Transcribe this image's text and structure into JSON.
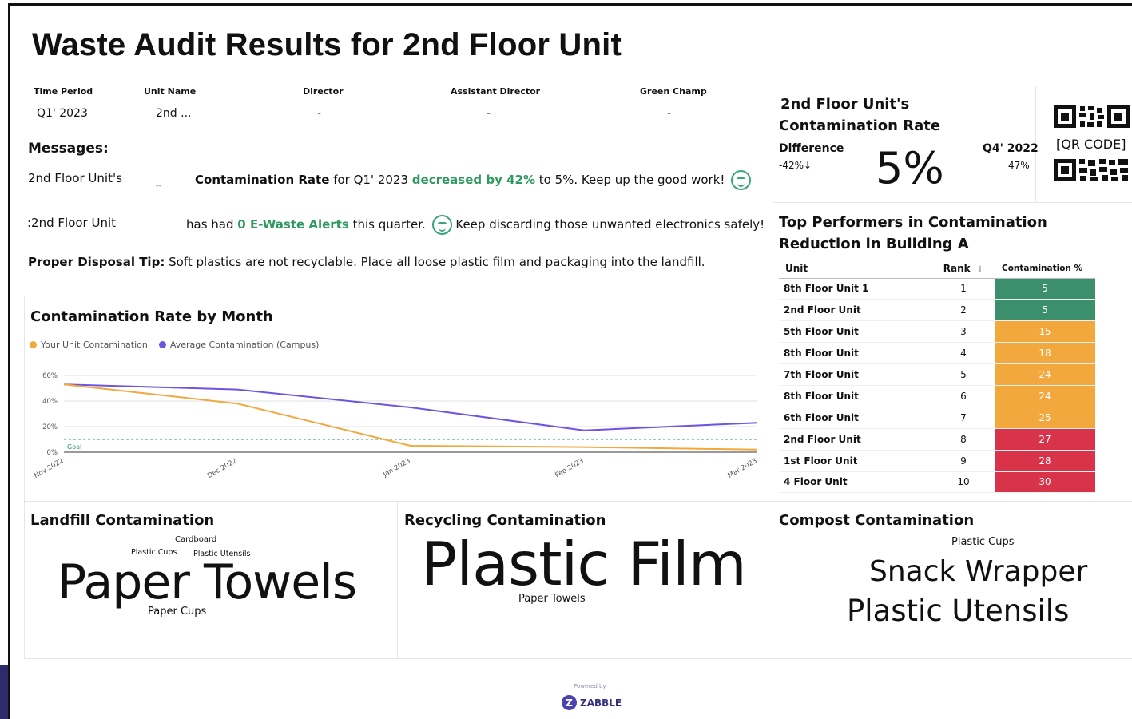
{
  "title": "Waste Audit Results for 2nd Floor Unit",
  "info": {
    "time_period_label": "Time Period",
    "time_period_value": "Q1' 2023",
    "unit_name_label": "Unit Name",
    "unit_name_value": "2nd ...",
    "director_label": "Director",
    "director_value": "-",
    "assistant_director_label": "Assistant Director",
    "assistant_director_value": "-",
    "green_champ_label": "Green Champ",
    "green_champ_value": "-"
  },
  "messages": {
    "heading": "Messages:",
    "msg1_unit": "2nd Floor Unit's",
    "msg1_dash": "--",
    "msg1_bold": "Contamination Rate",
    "msg1_mid": "for Q1' 2023",
    "msg1_green": "decreased by 42%",
    "msg1_end": "to 5%. Keep up the good work!",
    "msg2_unit": ":2nd Floor Unit",
    "msg2_pre": "has had",
    "msg2_green": "0 E-Waste Alerts",
    "msg2_end": "this quarter.",
    "msg2_tail": "Keep discarding those unwanted electronics safely!",
    "tip_bold": "Proper Disposal Tip:",
    "tip_text": "Soft plastics are not recyclable. Place all loose plastic film and packaging into the landfill."
  },
  "kpi": {
    "title_line1": "2nd Floor Unit's",
    "title_line2": "Contamination Rate",
    "difference_label": "Difference",
    "difference_value": "-42%↓",
    "big_value": "5%",
    "prev_label": "Q4' 2022",
    "prev_value": "47%",
    "qr_label": "[QR CODE]"
  },
  "top_performers": {
    "title": "Top Performers in Contamination Reduction in Building A",
    "headers": {
      "unit": "Unit",
      "rank": "Rank",
      "pct": "Contamination %"
    },
    "rows": [
      {
        "unit": "8th Floor Unit 1",
        "rank": "1",
        "pct": "5",
        "color": "#3c8f6d"
      },
      {
        "unit": "2nd  Floor Unit",
        "rank": "2",
        "pct": "5",
        "color": "#3c8f6d"
      },
      {
        "unit": "5th  Floor Unit",
        "rank": "3",
        "pct": "15",
        "color": "#f2a83c"
      },
      {
        "unit": "8th  Floor Unit",
        "rank": "4",
        "pct": "18",
        "color": "#f2a83c"
      },
      {
        "unit": "7th  Floor Unit",
        "rank": "5",
        "pct": "24",
        "color": "#f2a83c"
      },
      {
        "unit": "8th  Floor Unit",
        "rank": "6",
        "pct": "24",
        "color": "#f2a83c"
      },
      {
        "unit": "6th  Floor Unit",
        "rank": "7",
        "pct": "25",
        "color": "#f2a83c"
      },
      {
        "unit": "2nd  Floor Unit",
        "rank": "8",
        "pct": "27",
        "color": "#d9334a"
      },
      {
        "unit": "1st  Floor Unit",
        "rank": "9",
        "pct": "28",
        "color": "#d9334a"
      },
      {
        "unit": "4  Floor Unit",
        "rank": "10",
        "pct": "30",
        "color": "#d9334a"
      }
    ]
  },
  "chart_title": "Contamination Rate by Month",
  "chart_data": {
    "type": "line",
    "title": "Contamination Rate by Month",
    "categories": [
      "Nov 2022",
      "Dec 2022",
      "Jan 2023",
      "Feb 2023",
      "Mar 2023"
    ],
    "series": [
      {
        "name": "Your Unit Contamination",
        "color": "#f2a83c",
        "values": [
          53,
          38,
          5,
          4,
          2
        ]
      },
      {
        "name": "Average Contamination (Campus)",
        "color": "#6e54e0",
        "values": [
          53,
          49,
          35,
          17,
          23
        ]
      }
    ],
    "y_ticks": [
      "0%",
      "20%",
      "40%",
      "60%"
    ],
    "ylim": [
      0,
      60
    ],
    "goal": {
      "label": "Goal",
      "value": 10,
      "color": "#2e9a5f"
    },
    "legend_position": "top-left"
  },
  "wordclouds": {
    "landfill": {
      "title": "Landfill Contamination",
      "w1": "Cardboard",
      "w2": "Plastic Cups",
      "w3": "Plastic Utensils",
      "w4": "Paper Towels",
      "w5": "Paper Cups"
    },
    "recycling": {
      "title": "Recycling Contamination",
      "w1": "Plastic Film",
      "w2": "Paper Towels"
    },
    "compost": {
      "title": "Compost Contamination",
      "w1": "Plastic Cups",
      "w2": "Snack Wrapper",
      "w3": "Plastic Utensils"
    }
  },
  "footer": {
    "powered": "Powered by",
    "brand": "ZABBLE",
    "logo_letter": "Z"
  }
}
